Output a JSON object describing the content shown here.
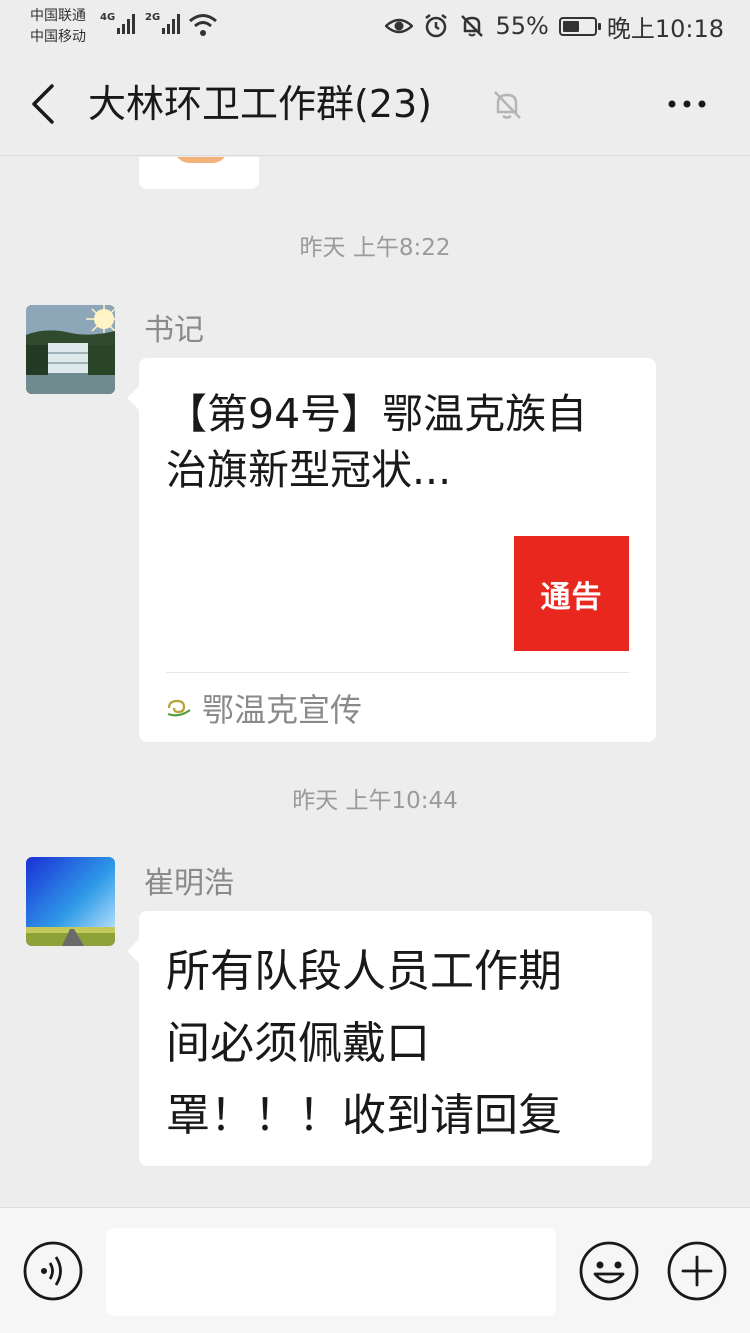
{
  "status_bar": {
    "carrier_1": "中国联通",
    "carrier_2": "中国移动",
    "net_1": "4G",
    "net_2": "2G",
    "battery": "55%",
    "battery_level": 0.55,
    "time": "晚上10:18",
    "icons": [
      "eye-icon",
      "alarm-icon",
      "mute-bell-icon",
      "battery-icon",
      "wifi-icon",
      "signal-icon"
    ]
  },
  "nav": {
    "title": "大林环卫工作群(23)",
    "icons": [
      "back-icon",
      "mute-bell-icon",
      "more-icon"
    ]
  },
  "messages": [
    {
      "timestamp": "昨天 上午8:22",
      "sender": "书记",
      "type": "card",
      "card": {
        "title": "【第94号】鄂温克族自治旗新型冠状...",
        "thumb_text": "通告",
        "source": "鄂温克宣传"
      }
    },
    {
      "timestamp": "昨天 上午10:44",
      "sender": "崔明浩",
      "type": "text",
      "text_lines": [
        "所有队段人员工作期",
        "间必须佩戴口",
        "罩！！！收到请回复"
      ]
    }
  ],
  "input_bar": {
    "placeholder": "",
    "icons": [
      "voice-icon",
      "emoji-icon",
      "plus-icon"
    ]
  },
  "colors": {
    "background": "#ededed",
    "bubble": "#ffffff",
    "notice_red": "#e8271f",
    "secondary_text": "#8a8a8a"
  }
}
